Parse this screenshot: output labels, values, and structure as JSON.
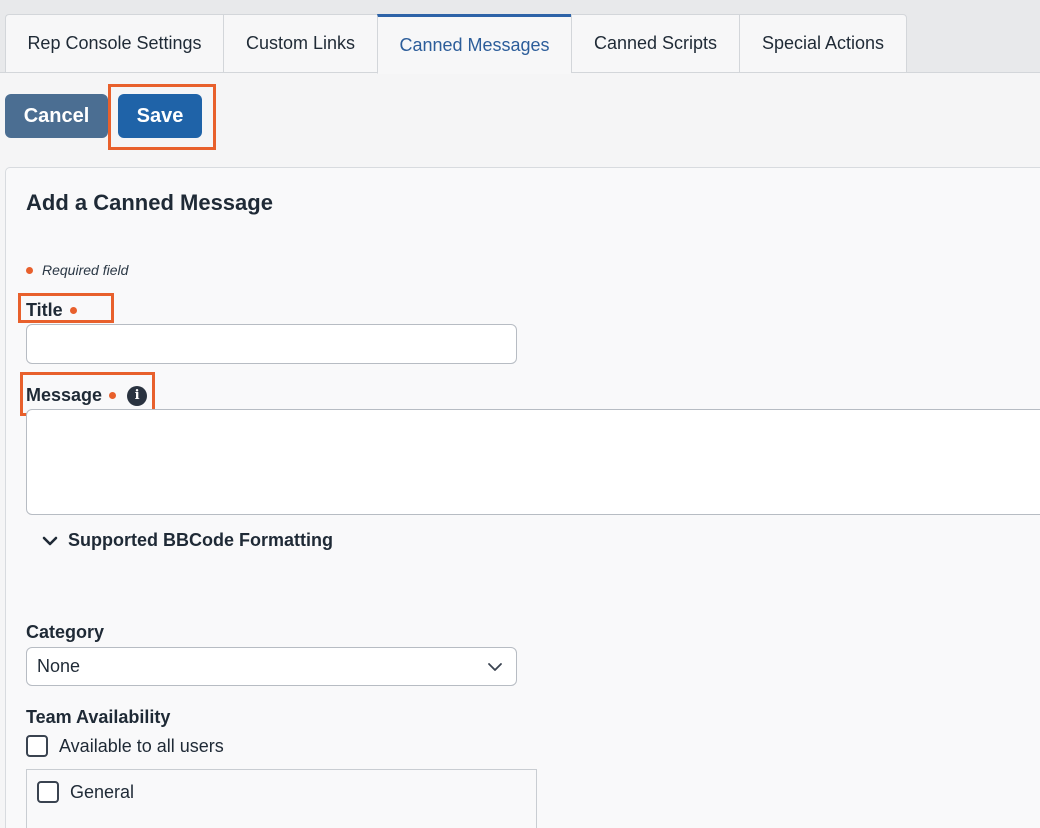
{
  "tabs": [
    {
      "label": "Rep Console Settings",
      "active": false
    },
    {
      "label": "Custom Links",
      "active": false
    },
    {
      "label": "Canned Messages",
      "active": true
    },
    {
      "label": "Canned Scripts",
      "active": false
    },
    {
      "label": "Special Actions",
      "active": false
    }
  ],
  "actions": {
    "cancel_label": "Cancel",
    "save_label": "Save"
  },
  "form": {
    "heading": "Add a Canned Message",
    "required_note": "Required field",
    "title_label": "Title",
    "title_value": "",
    "message_label": "Message",
    "message_value": "",
    "bbcode_toggle_label": "Supported BBCode Formatting",
    "category_label": "Category",
    "category_value": "None",
    "team_availability_label": "Team Availability",
    "all_users_label": "Available to all users",
    "all_users_checked": false,
    "teams": [
      {
        "label": "General",
        "checked": false
      }
    ]
  },
  "colors": {
    "accent": "#1f63a8",
    "required": "#e8602c",
    "highlight": "#e8602c",
    "cancel": "#4b6e92"
  },
  "icons": {
    "info": "info-circle-icon",
    "expand": "chevron-down-icon",
    "select": "chevron-down-icon"
  }
}
